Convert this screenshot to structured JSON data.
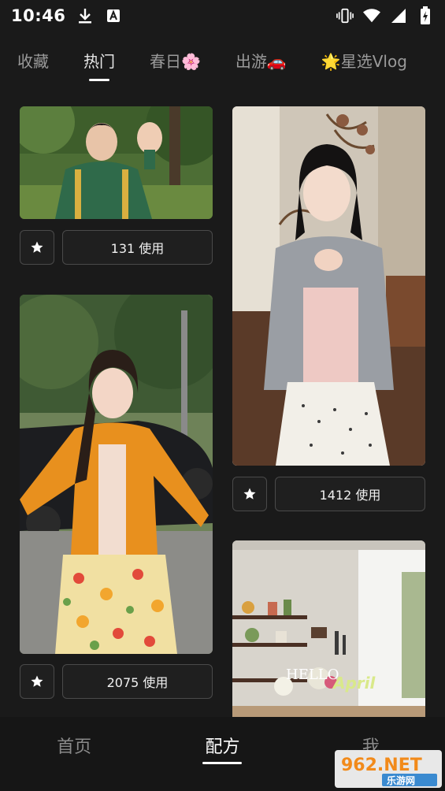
{
  "status_bar": {
    "time": "10:46",
    "left_icons": [
      "download-icon",
      "font-a-icon"
    ],
    "right_icons": [
      "vibrate-icon",
      "wifi-icon",
      "signal-icon",
      "battery-charging-icon"
    ]
  },
  "tabs": [
    {
      "label": "收藏",
      "active": false
    },
    {
      "label": "热门",
      "active": true
    },
    {
      "label": "春日🌸",
      "active": false
    },
    {
      "label": "出游🚗",
      "active": false
    },
    {
      "label": "🌟星选Vlog",
      "active": false
    }
  ],
  "cards": [
    {
      "uses": "131 使用",
      "image": "boy-waving-green-jacket"
    },
    {
      "uses": "1412 使用",
      "image": "girl-grey-cardigan-indoor"
    },
    {
      "uses": "2075 使用",
      "image": "girl-orange-cardigan-floral-skirt"
    },
    {
      "uses": "",
      "image": "kitchen-shelves-hello-april",
      "overlay_text": "HELLO April"
    }
  ],
  "bottom_nav": [
    {
      "label": "首页",
      "active": false
    },
    {
      "label": "配方",
      "active": true
    },
    {
      "label": "我",
      "active": false
    }
  ],
  "watermark": {
    "text": "962.NET",
    "subtext": "乐游网"
  },
  "colors": {
    "background": "#1a1a1a",
    "button_border": "#4a4a4a",
    "tab_inactive": "#9a9a9a",
    "active": "#ffffff"
  }
}
